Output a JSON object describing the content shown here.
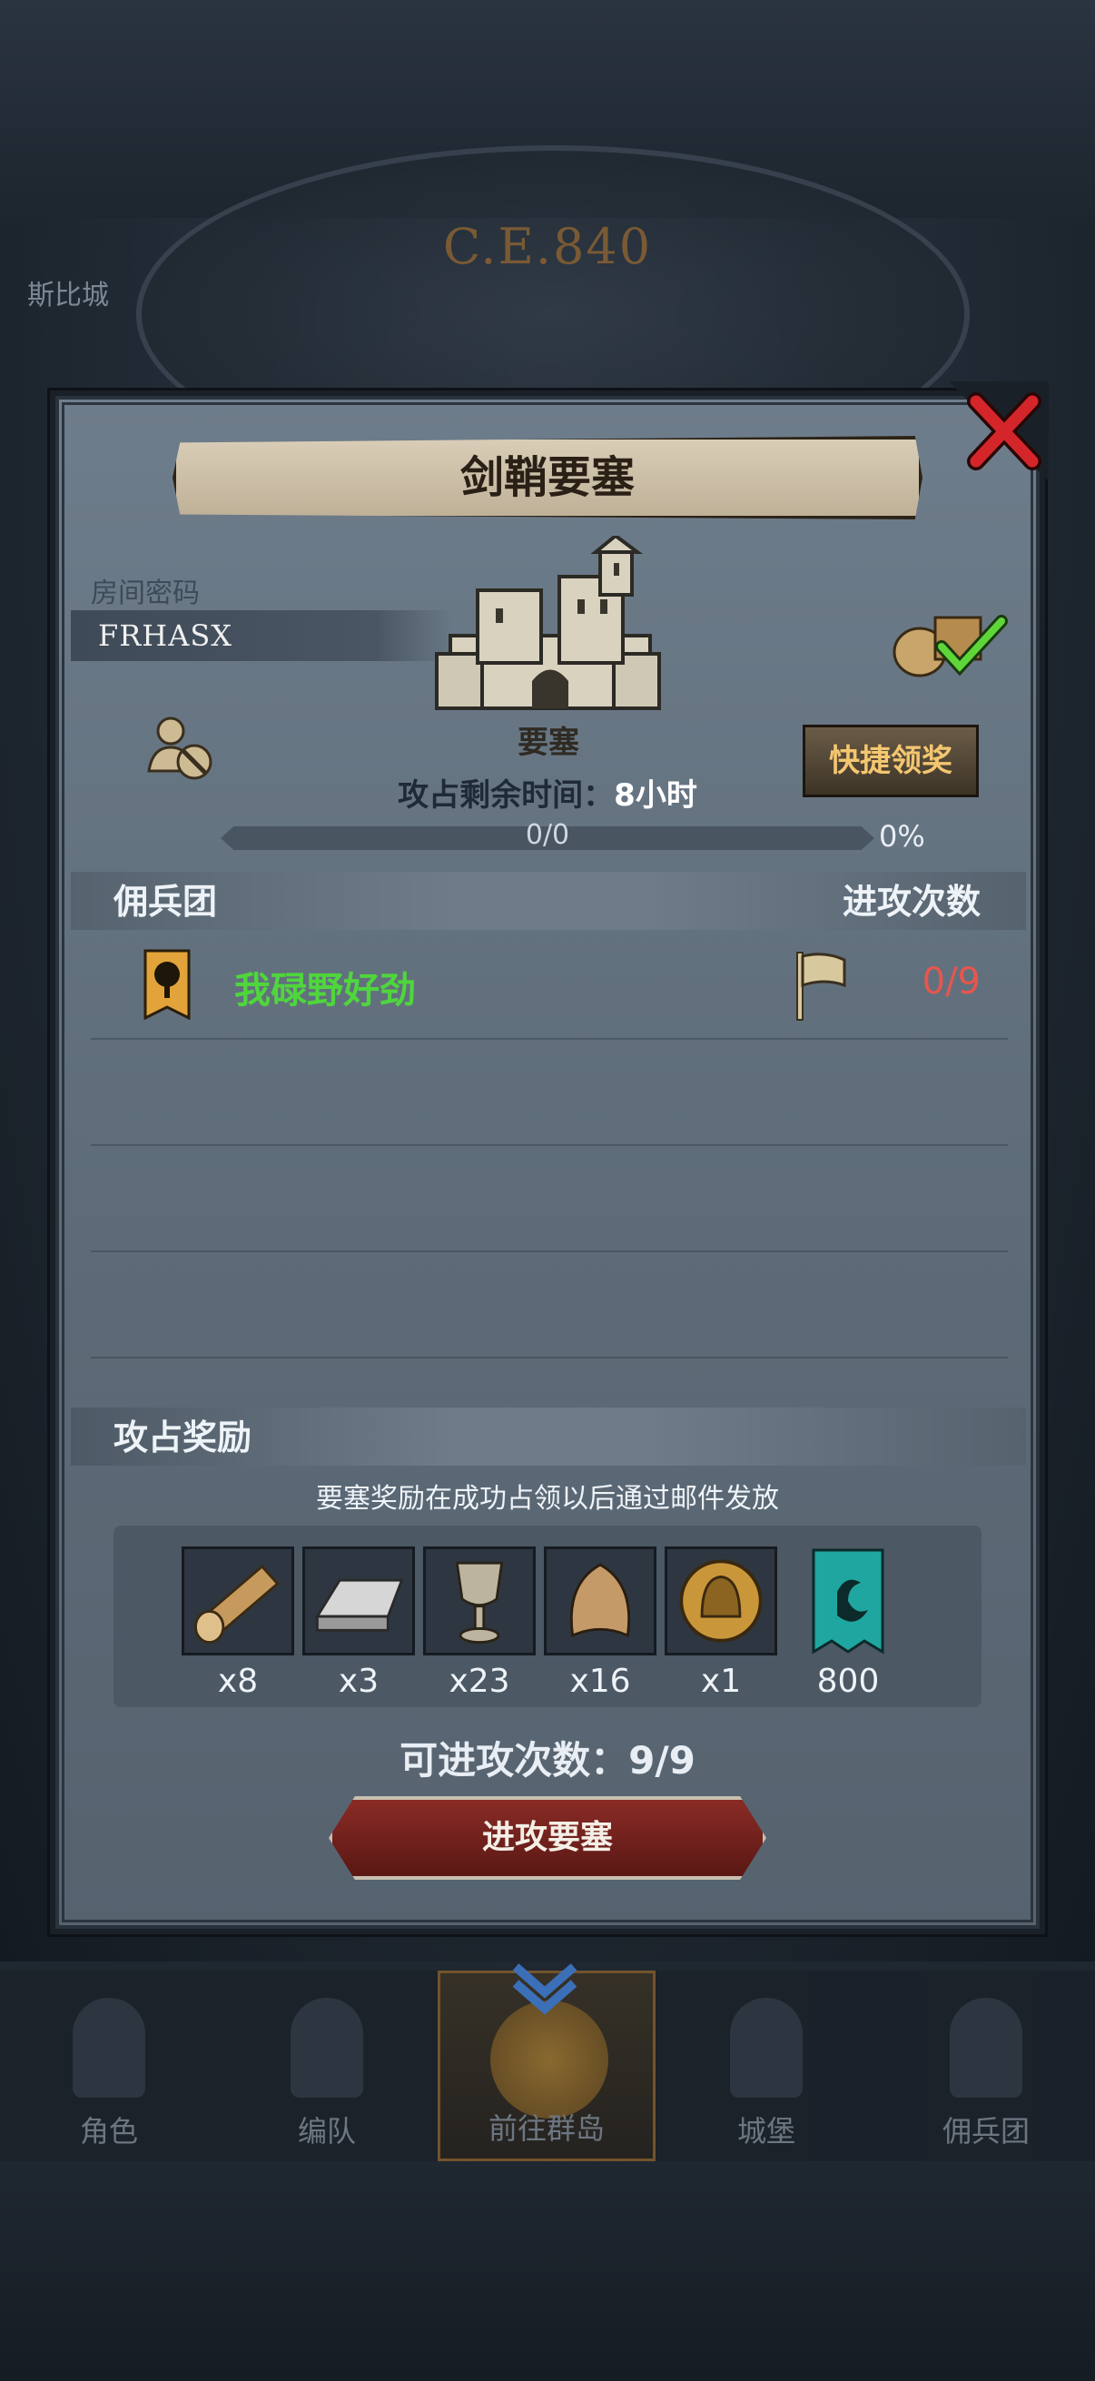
{
  "background": {
    "year_label": "C.E.840",
    "city_name": "斯比城"
  },
  "panel": {
    "title": "剑鞘要塞",
    "room": {
      "label": "房间密码",
      "code": "FRHASX"
    },
    "fortress_label": "要塞",
    "quick_claim_label": "快捷领奖",
    "time_remaining": {
      "label": "攻占剩余时间：",
      "value": "8小时"
    },
    "progress": {
      "text": "0/0",
      "percent": "0%",
      "value": 0
    },
    "mercenaries": {
      "header": "佣兵团",
      "attacks_header": "进攻次数",
      "rows": [
        {
          "name": "我碌野好劲",
          "attacks": "0/9"
        }
      ]
    },
    "rewards": {
      "header": "攻占奖励",
      "note": "要塞奖励在成功占领以后通过邮件发放",
      "items": [
        {
          "icon": "wood-log-icon",
          "qty": "x8"
        },
        {
          "icon": "iron-ingot-icon",
          "qty": "x3"
        },
        {
          "icon": "goblet-icon",
          "qty": "x23"
        },
        {
          "icon": "fur-pelt-icon",
          "qty": "x16"
        },
        {
          "icon": "knight-medal-icon",
          "qty": "x1"
        },
        {
          "icon": "guild-banner-icon",
          "qty": "800"
        }
      ]
    },
    "attemptable": "可进攻次数：9/9",
    "attack_button": "进攻要塞"
  },
  "nav": {
    "items": [
      "角色",
      "编队",
      "前往群岛",
      "城堡",
      "佣兵团"
    ],
    "active_index": 2
  },
  "colors": {
    "guild_name": "#4fd63c",
    "attack_count": "#e6564e",
    "quick_claim_text": "#f3c670",
    "attack_button": "#8a2b26",
    "close_x": "#d4262a"
  }
}
